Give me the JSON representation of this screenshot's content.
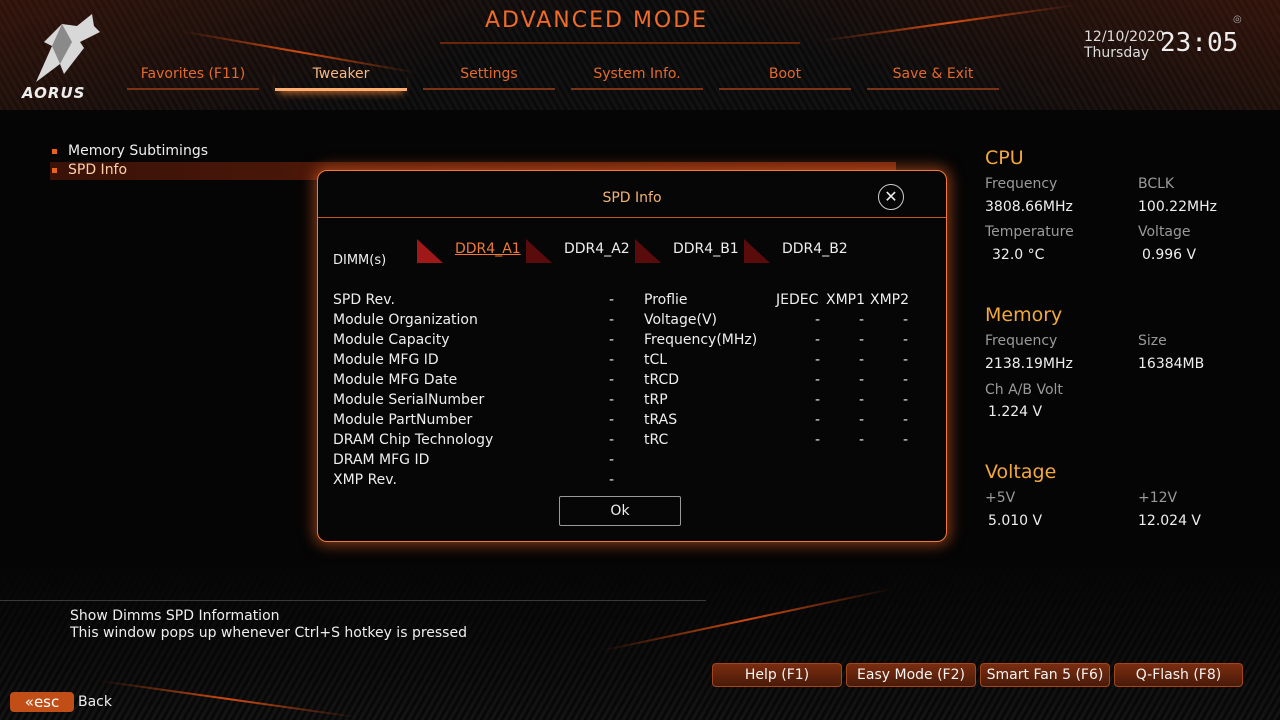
{
  "header": {
    "brand": "AORUS",
    "title": "ADVANCED MODE",
    "date": "12/10/2020",
    "day": "Thursday",
    "time": "23:05"
  },
  "tabs": [
    {
      "label": "Favorites (F11)"
    },
    {
      "label": "Tweaker"
    },
    {
      "label": "Settings"
    },
    {
      "label": "System Info."
    },
    {
      "label": "Boot"
    },
    {
      "label": "Save & Exit"
    }
  ],
  "active_tab": "Tweaker",
  "menu": {
    "items": [
      {
        "label": "Memory Subtimings"
      },
      {
        "label": "SPD Info"
      }
    ],
    "selected": "SPD Info"
  },
  "dialog": {
    "title": "SPD Info",
    "dimm_label": "DIMM(s)",
    "dimms": [
      "DDR4_A1",
      "DDR4_A2",
      "DDR4_B1",
      "DDR4_B2"
    ],
    "active_dimm": "DDR4_A1",
    "left_rows": [
      {
        "label": "SPD Rev.",
        "value": "-"
      },
      {
        "label": "Module Organization",
        "value": "-"
      },
      {
        "label": "Module Capacity",
        "value": "-"
      },
      {
        "label": "Module MFG ID",
        "value": "-"
      },
      {
        "label": "Module MFG Date",
        "value": "-"
      },
      {
        "label": "Module SerialNumber",
        "value": "-"
      },
      {
        "label": "Module PartNumber",
        "value": "-"
      },
      {
        "label": "DRAM Chip Technology",
        "value": "-"
      },
      {
        "label": "DRAM MFG ID",
        "value": "-"
      },
      {
        "label": "XMP Rev.",
        "value": "-"
      }
    ],
    "profile_header": {
      "label": "Proflie",
      "cols": [
        "JEDEC",
        "XMP1",
        "XMP2"
      ]
    },
    "profile_rows": [
      {
        "label": "Voltage(V)",
        "values": [
          "-",
          "-",
          "-"
        ]
      },
      {
        "label": "Frequency(MHz)",
        "values": [
          "-",
          "-",
          "-"
        ]
      },
      {
        "label": "tCL",
        "values": [
          "-",
          "-",
          "-"
        ]
      },
      {
        "label": "tRCD",
        "values": [
          "-",
          "-",
          "-"
        ]
      },
      {
        "label": "tRP",
        "values": [
          "-",
          "-",
          "-"
        ]
      },
      {
        "label": "tRAS",
        "values": [
          "-",
          "-",
          "-"
        ]
      },
      {
        "label": "tRC",
        "values": [
          "-",
          "-",
          "-"
        ]
      }
    ],
    "ok_label": "Ok"
  },
  "side_panel": {
    "cpu": {
      "title": "CPU",
      "freq_label": "Frequency",
      "freq": "3808.66MHz",
      "bclk_label": "BCLK",
      "bclk": "100.22MHz",
      "temp_label": "Temperature",
      "temp": "32.0 °C",
      "volt_label": "Voltage",
      "volt": "0.996 V"
    },
    "memory": {
      "title": "Memory",
      "freq_label": "Frequency",
      "freq": "2138.19MHz",
      "size_label": "Size",
      "size": "16384MB",
      "chab_label": "Ch A/B Volt",
      "chab": "1.224 V"
    },
    "voltage": {
      "title": "Voltage",
      "v5_label": "+5V",
      "v5": "5.010 V",
      "v12_label": "+12V",
      "v12": "12.024 V"
    }
  },
  "help": {
    "line1": "Show Dimms SPD Information",
    "line2": "This window pops up whenever Ctrl+S hotkey is pressed"
  },
  "footer": {
    "buttons": [
      "Help (F1)",
      "Easy Mode (F2)",
      "Smart Fan 5 (F6)",
      "Q-Flash (F8)"
    ],
    "esc": "esc",
    "back": "Back"
  },
  "colors": {
    "accent": "#f06a28",
    "panel_title": "#f3a83c"
  }
}
